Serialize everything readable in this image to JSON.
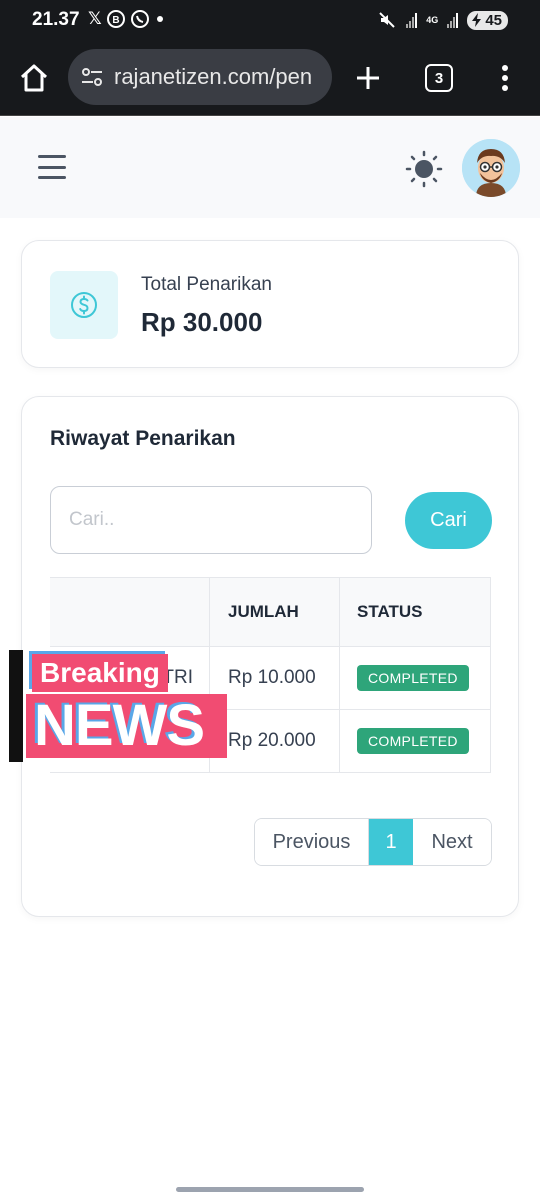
{
  "status_bar": {
    "time": "21.37",
    "left_icons": [
      "x-icon",
      "whatsapp-business-icon",
      "whatsapp-icon",
      "dot-icon"
    ],
    "network": "4G",
    "battery": "45"
  },
  "browser": {
    "url": "rajanetizen.com/pen",
    "tab_count": "3"
  },
  "summary": {
    "label": "Total Penarikan",
    "value": "Rp 30.000"
  },
  "history": {
    "title": "Riwayat Penarikan",
    "search_placeholder": "Cari..",
    "search_button": "Cari",
    "columns": [
      "",
      "JUMLAH",
      "STATUS"
    ],
    "rows": [
      {
        "name": "TRI",
        "amount": "Rp 10.000",
        "status": "COMPLETED"
      },
      {
        "name": "",
        "amount": "Rp 20.000",
        "status": "COMPLETED"
      }
    ]
  },
  "pagination": {
    "previous": "Previous",
    "current": "1",
    "next": "Next"
  },
  "overlay": {
    "line1": "Breaking",
    "line2": "NEWS"
  },
  "colors": {
    "accent": "#3ec7d6",
    "status_completed": "#2ea57a",
    "overlay_red": "#f14c72",
    "overlay_blue": "#59a7e8"
  }
}
